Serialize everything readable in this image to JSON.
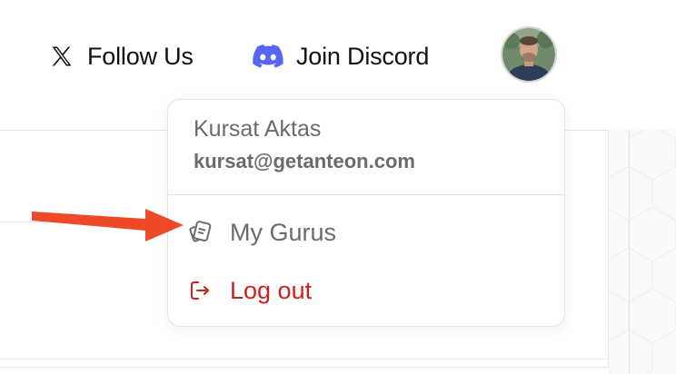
{
  "nav": {
    "follow_label": "Follow Us",
    "follow_icon": "x-logo-icon",
    "discord_label": "Join Discord",
    "discord_icon": "discord-icon",
    "discord_color": "#5865F2"
  },
  "user_menu": {
    "name": "Kursat Aktas",
    "email": "kursat@getanteon.com",
    "items": [
      {
        "label": "My Gurus",
        "icon": "gurus-icon",
        "color": "#6b6b6b"
      },
      {
        "label": "Log out",
        "icon": "logout-icon",
        "color": "#d11f1f"
      }
    ]
  },
  "annotation": {
    "arrow_color": "#ee4a2a"
  }
}
